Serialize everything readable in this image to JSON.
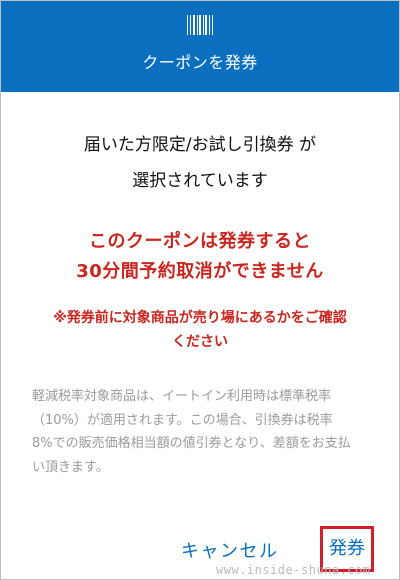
{
  "header": {
    "icon": "barcode-icon",
    "title": "クーポンを発券"
  },
  "message": {
    "line1": "届いた方限定/お試し引換券 が",
    "line2": "選択されています"
  },
  "warning": {
    "line1": "このクーポンは発券すると",
    "line2": "30分間予約取消ができません"
  },
  "notice": {
    "line1": "※発券前に対象商品が売り場にあるかをご確認",
    "line2": "ください"
  },
  "tax_note": {
    "line1": "軽減税率対象商品は、イートイン利用時は標準税率",
    "line2": "（10%）が適用されます。この場合、引換券は税率",
    "line3": "8%での販売価格相当額の値引券となり、差額をお支払",
    "line4": "い頂きます。"
  },
  "buttons": {
    "cancel": "キャンセル",
    "issue": "発券"
  },
  "watermark": "www.inside-shuna.com",
  "colors": {
    "header_bg": "#0a6fbf",
    "warning_text": "#c8261f",
    "link_text": "#0a6fbf",
    "highlight_border": "#d11f2d"
  }
}
